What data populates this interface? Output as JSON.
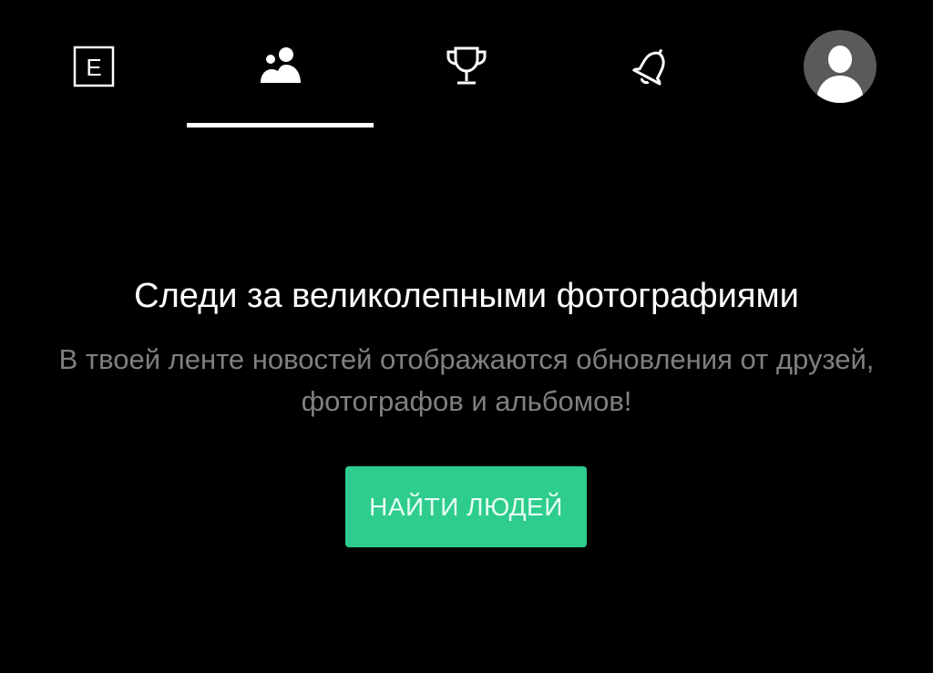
{
  "nav": {
    "items": [
      {
        "icon": "logo-icon",
        "logo_letter": "E"
      },
      {
        "icon": "people-icon",
        "active": true
      },
      {
        "icon": "trophy-icon"
      },
      {
        "icon": "bell-icon"
      },
      {
        "icon": "avatar-icon"
      }
    ]
  },
  "empty_state": {
    "title": "Следи за великолепными фотографиями",
    "subtitle": "В твоей ленте новостей отображаются обновления от друзей, фотографов и альбомов!",
    "button_label": "НАЙТИ ЛЮДЕЙ"
  },
  "colors": {
    "background": "#000000",
    "accent": "#2ecc8e",
    "subtitle": "#808080",
    "avatar_bg": "#5a5a5a"
  }
}
